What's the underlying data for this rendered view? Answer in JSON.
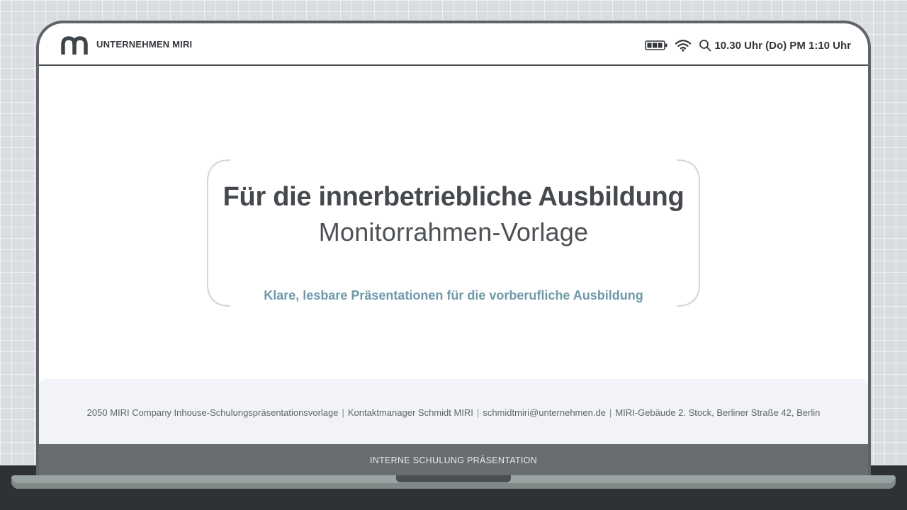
{
  "header": {
    "brand_name": "UNTERNEHMEN MIRI",
    "logo": "miri-m-logo",
    "status_icons": [
      "battery-icon",
      "wifi-icon",
      "search-icon"
    ],
    "clock_text": "10.30 Uhr (Do) PM 1:10 Uhr"
  },
  "main": {
    "headline": "Für die innerbetriebliche Ausbildung",
    "subheadline": "Monitorrahmen-Vorlage",
    "tagline": "Klare, lesbare Präsentationen für die vorberufliche Ausbildung"
  },
  "footer": {
    "items": [
      "2050 MIRI Company Inhouse-Schulungspräsentationsvorlage",
      "Kontaktmanager Schmidt MIRI",
      "schmidtmiri@unternehmen.de",
      "MIRI-Gebäude 2. Stock, Berliner Straße 42, Berlin"
    ],
    "separator": "|"
  },
  "bottom_bar": {
    "label": "INTERNE SCHULUNG PRÄSENTATION"
  },
  "colors": {
    "frame": "#5f6469",
    "headline": "#45494d",
    "tagline": "#6f9aaa",
    "footer_band": "#f2f3f9",
    "desk": "#2e3236",
    "base": "#9aa5a3"
  }
}
